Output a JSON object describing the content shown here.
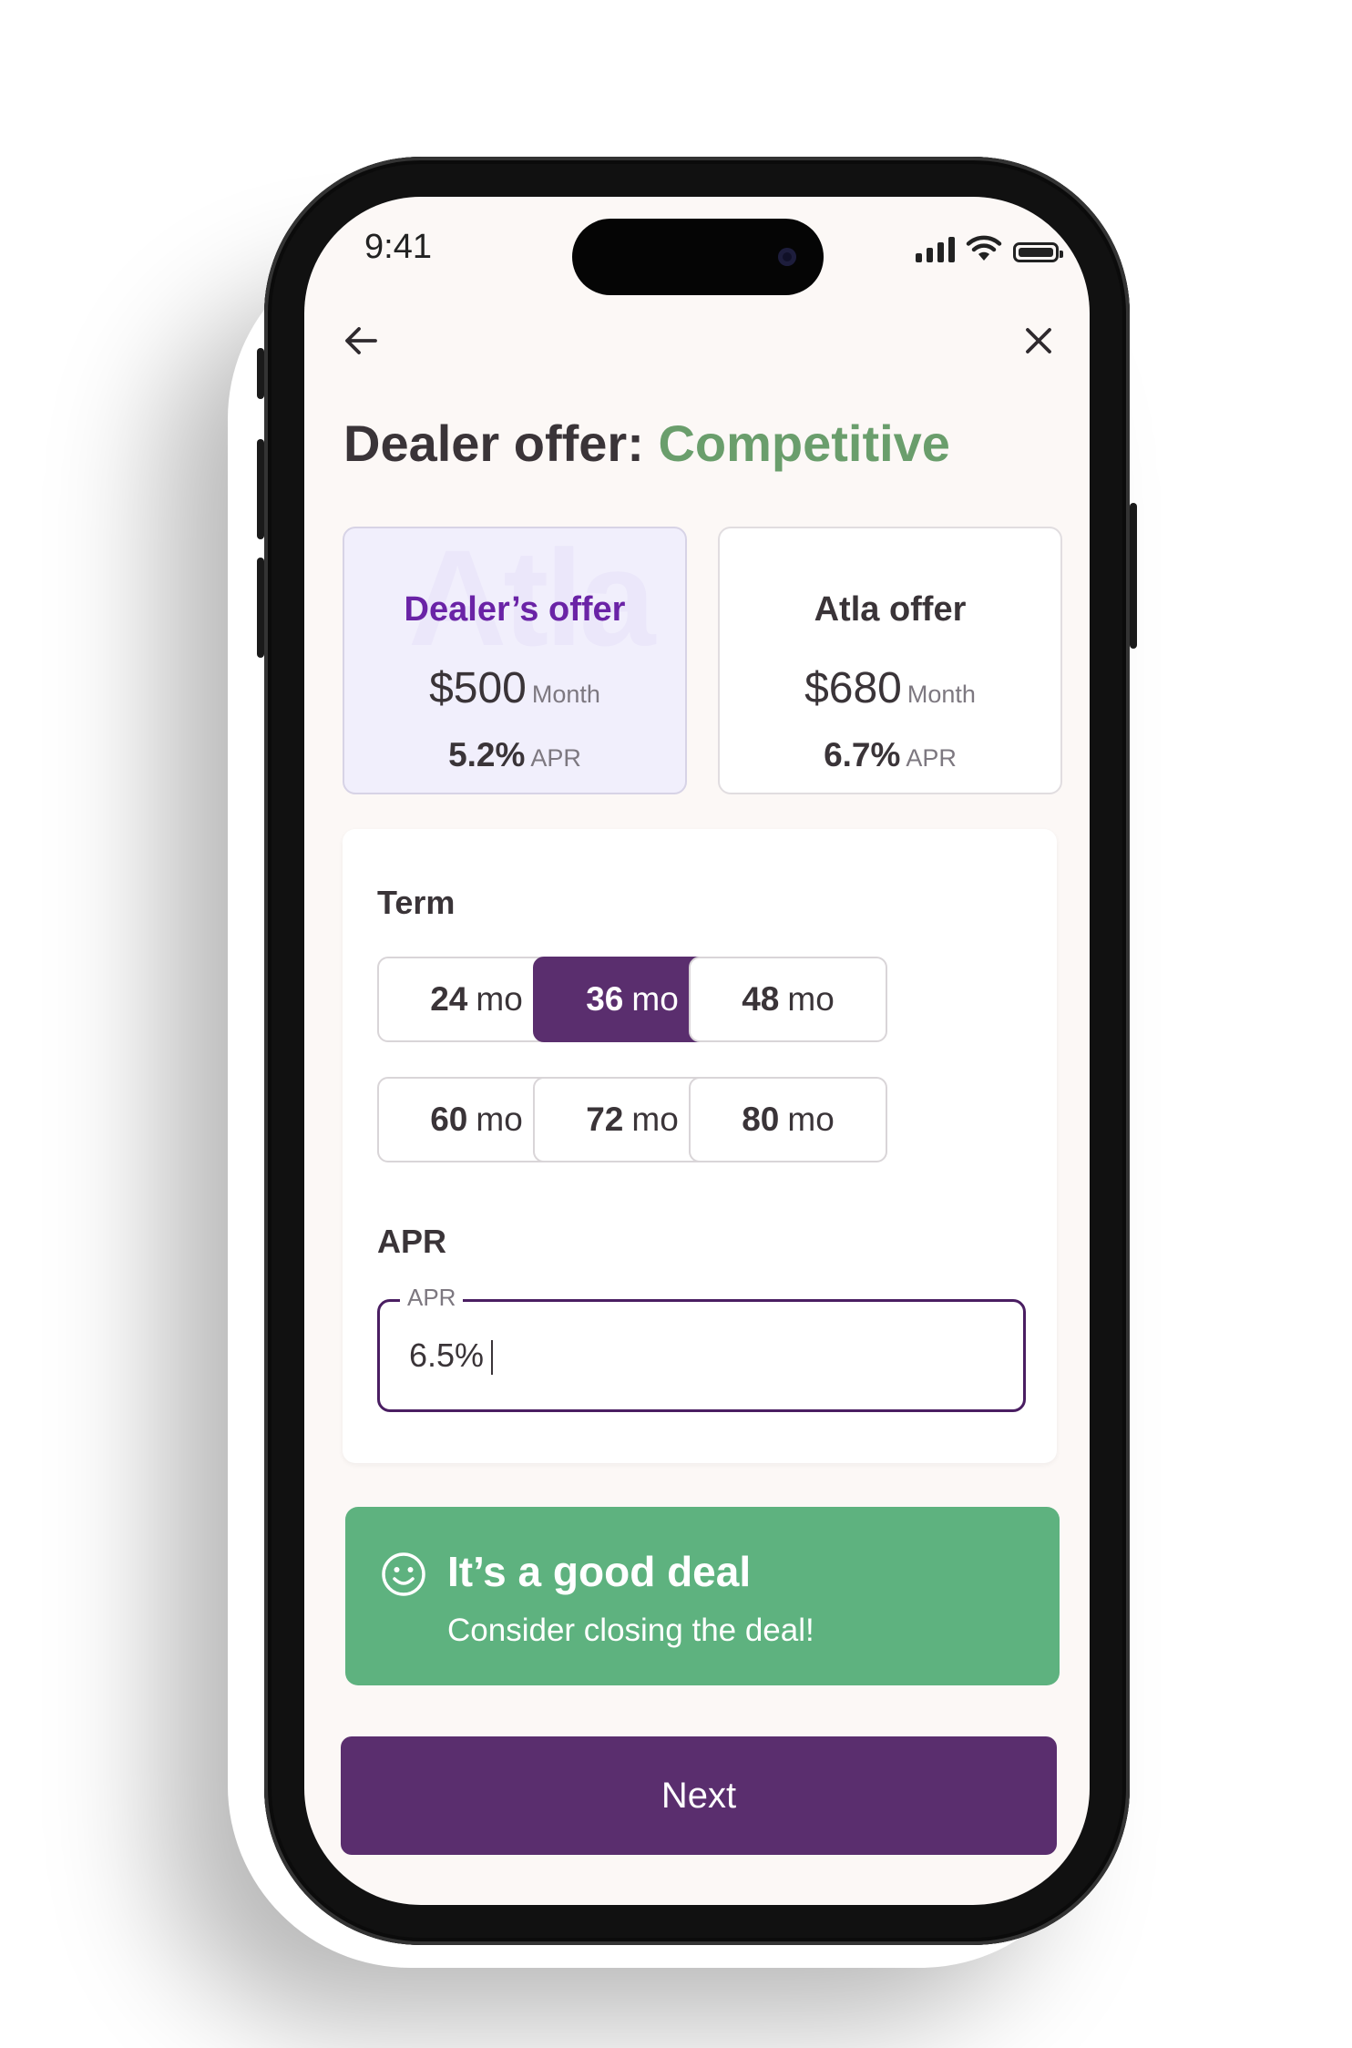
{
  "status_bar": {
    "time": "9:41",
    "icons": [
      "cellular-signal-icon",
      "wifi-icon",
      "battery-icon"
    ]
  },
  "nav": {
    "back_icon": "arrow-left-icon",
    "close_icon": "close-icon"
  },
  "header": {
    "title_prefix": "Dealer offer:",
    "title_status": "Competitive"
  },
  "offers": {
    "dealer": {
      "name": "Dealer’s offer",
      "watermark": "Atla",
      "amount": "$500",
      "period": "Month",
      "apr": "5.2%",
      "apr_label": "APR"
    },
    "atla": {
      "name": "Atla offer",
      "amount": "$680",
      "period": "Month",
      "apr": "6.7%",
      "apr_label": "APR"
    }
  },
  "term": {
    "label": "Term",
    "selected": "36",
    "unit": "mo",
    "options": [
      {
        "num": "24",
        "unit": "mo"
      },
      {
        "num": "36",
        "unit": "mo"
      },
      {
        "num": "48",
        "unit": "mo"
      },
      {
        "num": "60",
        "unit": "mo"
      },
      {
        "num": "72",
        "unit": "mo"
      },
      {
        "num": "80",
        "unit": "mo"
      }
    ]
  },
  "apr_section": {
    "label": "APR",
    "field_label": "APR",
    "value": "6.5%"
  },
  "deal_banner": {
    "icon": "smiley-face-icon",
    "title": "It’s a good deal",
    "subtitle": "Consider closing the deal!"
  },
  "next_button": {
    "label": "Next"
  },
  "colors": {
    "primary": "#5a2e6e",
    "success": "#5eb27f",
    "status_accent": "#6a9e6c",
    "dealer_accent": "#6a23a6",
    "screen_background": "#fcf8f6"
  }
}
